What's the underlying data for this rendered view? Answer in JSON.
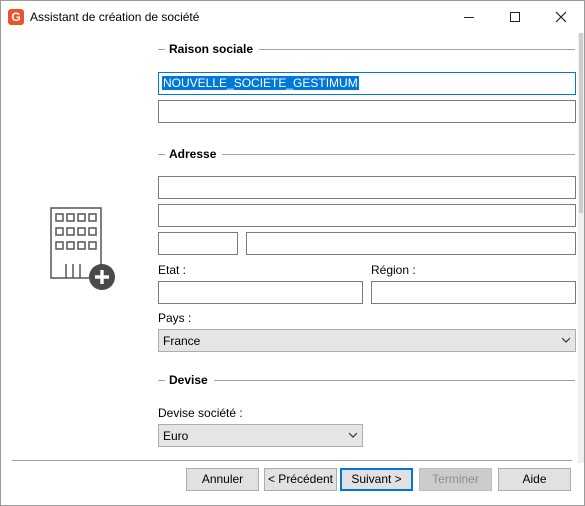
{
  "window": {
    "title": "Assistant de création de société",
    "app_icon_letter": "G",
    "accent_color": "#0078d7"
  },
  "sections": {
    "raison_sociale": "Raison sociale",
    "adresse": "Adresse",
    "devise": "Devise"
  },
  "fields": {
    "raison_sociale_1": "NOUVELLE_SOCIETE_GESTIMUM",
    "raison_sociale_2": "",
    "adresse_1": "",
    "adresse_2": "",
    "code_postal": "",
    "ville": "",
    "etat": "",
    "region": ""
  },
  "labels": {
    "etat": "Etat :",
    "region": "Région :",
    "pays": "Pays :",
    "devise_societe": "Devise société :"
  },
  "selects": {
    "pays": "France",
    "devise": "Euro"
  },
  "buttons": {
    "annuler": "Annuler",
    "precedent": "< Précédent",
    "suivant": "Suivant >",
    "terminer": "Terminer",
    "aide": "Aide"
  },
  "icons": {
    "illustration": "building-add-icon"
  }
}
